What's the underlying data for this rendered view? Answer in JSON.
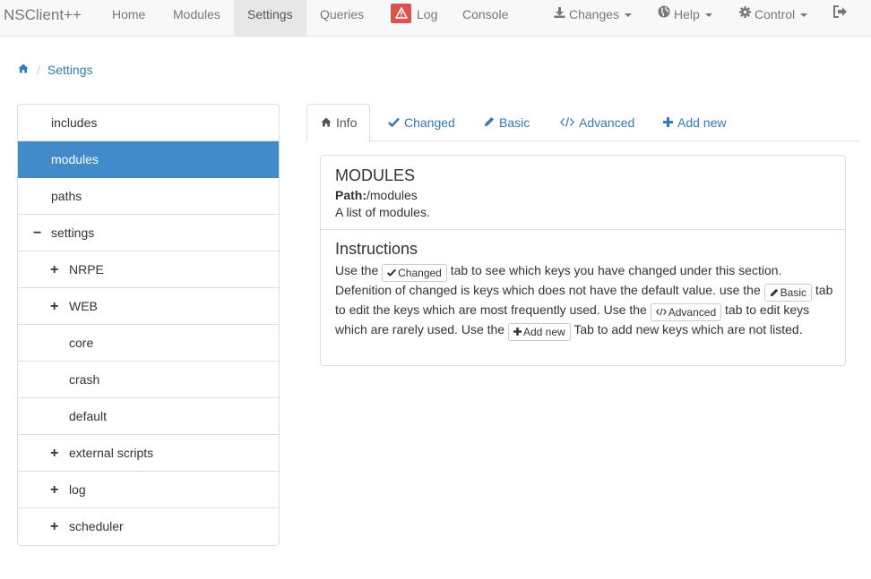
{
  "navbar": {
    "brand": "NSClient++",
    "items": [
      {
        "label": "Home"
      },
      {
        "label": "Modules"
      },
      {
        "label": "Settings",
        "active": true
      },
      {
        "label": "Queries"
      },
      {
        "label": "Log",
        "icon": "warning-icon"
      },
      {
        "label": "Console"
      }
    ],
    "right": [
      {
        "label": "Changes",
        "icon": "download-icon"
      },
      {
        "label": "Help",
        "icon": "globe-icon"
      },
      {
        "label": "Control",
        "icon": "cog-icon"
      },
      {
        "icon": "logout-icon"
      }
    ]
  },
  "breadcrumb": {
    "home_icon": "home-icon",
    "current": "Settings"
  },
  "tree": [
    {
      "label": "includes"
    },
    {
      "label": "modules",
      "active": true
    },
    {
      "label": "paths"
    },
    {
      "label": "settings",
      "toggle": "−"
    },
    {
      "label": "NRPE",
      "toggle": "+"
    },
    {
      "label": "WEB",
      "toggle": "+"
    },
    {
      "label": "core"
    },
    {
      "label": "crash"
    },
    {
      "label": "default"
    },
    {
      "label": "external scripts",
      "toggle": "+"
    },
    {
      "label": "log",
      "toggle": "+"
    },
    {
      "label": "scheduler",
      "toggle": "+"
    }
  ],
  "tabs": [
    {
      "label": "Info",
      "icon": "home-icon",
      "active": true
    },
    {
      "label": "Changed",
      "icon": "check-icon"
    },
    {
      "label": "Basic",
      "icon": "pencil-icon"
    },
    {
      "label": "Advanced",
      "icon": "code-icon"
    },
    {
      "label": "Add new",
      "icon": "plus-icon"
    }
  ],
  "panel": {
    "title": "MODULES",
    "path_label": "Path:",
    "path_value": "/modules",
    "description": "A list of modules.",
    "instructions_title": "Instructions",
    "instr": {
      "t1": "Use the ",
      "b1": "Changed",
      "t2": " tab to see which keys you have changed under this section. Defenition of changed is keys which does not have the default value. use the ",
      "b2": "Basic",
      "t3": " tab to edit the keys which are most frequently used. Use the ",
      "b3": "Advanced",
      "t4": " tab to edit keys which are rarely used. Use the ",
      "b4": "Add new",
      "t5": " Tab to add new keys which are not listed."
    }
  },
  "colors": {
    "primary": "#337ab7",
    "active_item": "#428bca",
    "danger": "#d9534f"
  }
}
